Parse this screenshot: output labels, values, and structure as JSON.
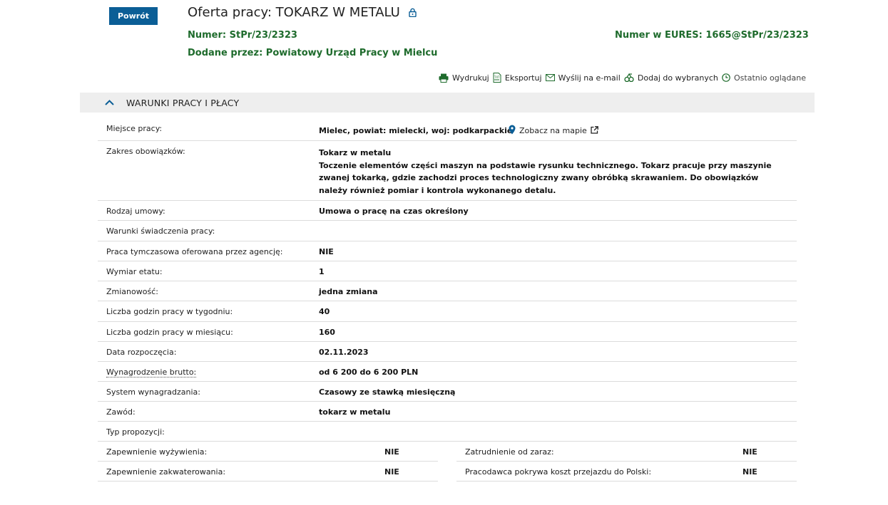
{
  "header": {
    "back_label": "Powrót",
    "title": "Oferta pracy: TOKARZ W METALU",
    "number_label": "Numer:",
    "number_value": "StPr/23/2323",
    "eures_label": "Numer w EURES:",
    "eures_value": "1665@StPr/23/2323",
    "added_label": "Dodane przez:",
    "added_value": "Powiatowy Urząd Pracy w Mielcu"
  },
  "toolbar": {
    "print": "Wydrukuj",
    "export": "Eksportuj",
    "email": "Wyślij na e-mail",
    "favorite": "Dodaj do wybranych",
    "recent": "Ostatnio oglądane"
  },
  "section": {
    "title": "WARUNKI PRACY I PŁACY"
  },
  "rows": {
    "place_label": "Miejsce pracy:",
    "place_value": "Mielec, powiat: mielecki, woj: podkarpackie",
    "map_link": "Zobacz na mapie",
    "duties_label": "Zakres obowiązków:",
    "duties_title": "Tokarz w metalu",
    "duties_text": "Toczenie elementów części maszyn na podstawie rysunku technicznego. Tokarz pracuje przy maszynie zwanej tokarką, gdzie zachodzi proces technologiczny zwany obróbką skrawaniem. Do obowiązków należy również pomiar i kontrola wykonanego detalu.",
    "contract_label": "Rodzaj umowy:",
    "contract_value": "Umowa o pracę na czas określony",
    "conditions_label": "Warunki świadczenia pracy:",
    "agency_label": "Praca tymczasowa oferowana przez agencję:",
    "agency_value": "NIE",
    "fte_label": "Wymiar etatu:",
    "fte_value": "1",
    "shifts_label": "Zmianowość:",
    "shifts_value": "jedna zmiana",
    "hours_week_label": "Liczba godzin pracy w tygodniu:",
    "hours_week_value": "40",
    "hours_month_label": "Liczba godzin pracy w miesiącu:",
    "hours_month_value": "160",
    "start_label": "Data rozpoczęcia:",
    "start_value": "02.11.2023",
    "salary_label": "Wynagrodzenie brutto:",
    "salary_value": "od 6 200 do 6 200 PLN",
    "pay_system_label": "System wynagradzania:",
    "pay_system_value": "Czasowy ze stawką miesięczną",
    "profession_label": "Zawód:",
    "profession_value": "tokarz w metalu",
    "proposal_label": "Typ propozycji:",
    "food_label": "Zapewnienie wyżywienia:",
    "food_value": "NIE",
    "immediate_label": "Zatrudnienie od zaraz:",
    "immediate_value": "NIE",
    "housing_label": "Zapewnienie zakwaterowania:",
    "housing_value": "NIE",
    "travel_label": "Pracodawca pokrywa koszt przejazdu do Polski:",
    "travel_value": "NIE"
  },
  "colors": {
    "primary": "#0b5e96",
    "green": "#1e6b2c",
    "section_bg": "#eeeeee"
  }
}
